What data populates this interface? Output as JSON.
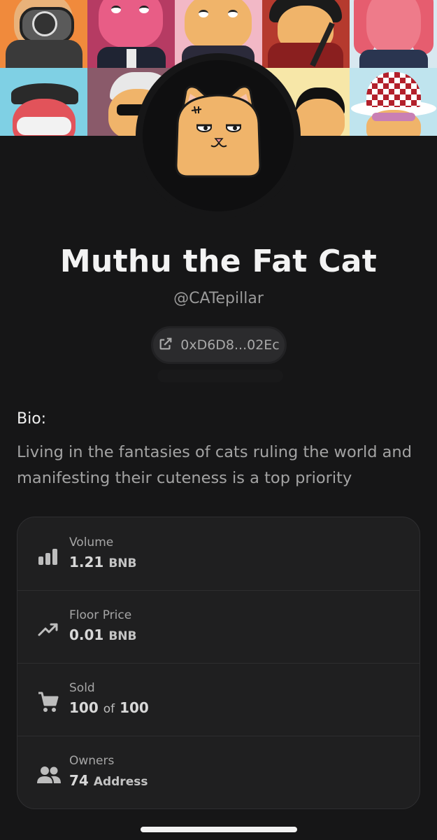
{
  "profile": {
    "name": "Muthu the Fat Cat",
    "handle": "@CATepillar",
    "address": "0xD6D8...02Ec"
  },
  "bio": {
    "label": "Bio:",
    "text": "Living in the fantasies of cats ruling the world and manifesting their cuteness is a top priority"
  },
  "stats": {
    "volume": {
      "label": "Volume",
      "value": "1.21",
      "unit": "BNB",
      "icon": "bar-chart-icon"
    },
    "floor": {
      "label": "Floor Price",
      "value": "0.01",
      "unit": "BNB",
      "icon": "trending-up-icon"
    },
    "sold": {
      "label": "Sold",
      "value": "100",
      "of": "of",
      "total": "100",
      "icon": "cart-icon"
    },
    "owners": {
      "label": "Owners",
      "value": "74",
      "unit": "Address",
      "icon": "people-icon"
    }
  },
  "colors": {
    "background": "#161617",
    "card": "#1f1f20",
    "muted": "#a3a3a3"
  }
}
